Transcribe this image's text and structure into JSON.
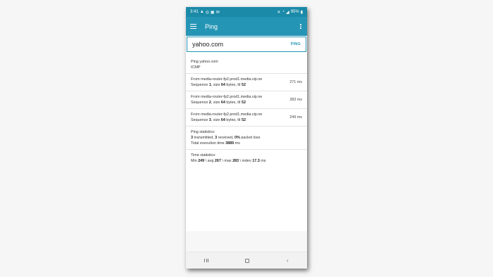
{
  "status_bar": {
    "time": "3:41",
    "left_icons": [
      "warning-icon",
      "whatsapp-icon",
      "image-icon",
      "mail-icon"
    ],
    "right_icons": [
      "mute-icon",
      "wifi-icon",
      "signal-icon",
      "battery-icon"
    ],
    "battery": "95%"
  },
  "app_bar": {
    "title": "Ping"
  },
  "host_input": {
    "value": "yahoo.com",
    "button_label": "PING"
  },
  "results": {
    "header": {
      "line1": "Ping yahoo.com",
      "line2": "ICMP"
    },
    "replies": [
      {
        "from": "From media-router-fp2.prod1.media.vip.ne",
        "seq_label": "Sequence ",
        "seq": "1",
        "size_label": ", size ",
        "size": "64",
        "bytes_label": " bytes, ttl ",
        "ttl": "52",
        "time": "271 ms"
      },
      {
        "from": "From media-router-fp2.prod1.media.vip.ne",
        "seq_label": "Sequence ",
        "seq": "2",
        "size_label": ", size ",
        "size": "64",
        "bytes_label": " bytes, ttl ",
        "ttl": "52",
        "time": "283 ms"
      },
      {
        "from": "From media-router-fp2.prod1.media.vip.ne",
        "seq_label": "Sequence ",
        "seq": "3",
        "size_label": ", size ",
        "size": "64",
        "bytes_label": " bytes, ttl ",
        "ttl": "52",
        "time": "249 ms"
      }
    ],
    "ping_stats": {
      "title": "Ping statistics:",
      "transmitted": "3",
      "transmitted_label": " transmitted, ",
      "received": "3",
      "received_label": " received, ",
      "loss": "0%",
      "loss_label": " packet loss",
      "exec_label": "Total execution time ",
      "exec_time": "3889",
      "exec_unit": " ms"
    },
    "time_stats": {
      "title": "Time statistics:",
      "min_label": "Min ",
      "min": "249",
      "avg_label": " \\ avg ",
      "avg": "267",
      "max_label": " \\ max ",
      "max": "283",
      "mdev_label": " \\ mdev ",
      "mdev": "17.3",
      "unit": " ms"
    }
  },
  "nav_bar": {
    "icons": [
      "recents-icon",
      "home-icon",
      "back-icon"
    ]
  },
  "colors": {
    "accent": "#2595b5",
    "status": "#1a8aa8"
  }
}
